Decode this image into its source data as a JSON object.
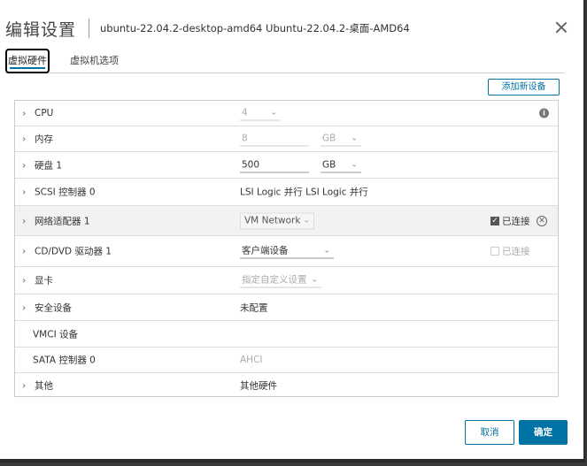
{
  "dialog": {
    "title": "编辑设置",
    "subtitle": "ubuntu-22.04.2-desktop-amd64 Ubuntu-22.04.2-桌面-AMD64"
  },
  "tabs": [
    {
      "label": "虚拟硬件",
      "active": true
    },
    {
      "label": "虚拟机选项",
      "active": false
    }
  ],
  "add_device_label": "添加新设备",
  "hardware": {
    "cpu": {
      "label": "CPU",
      "value": "4"
    },
    "memory": {
      "label": "内存",
      "value": "8",
      "unit": "GB"
    },
    "disk": {
      "label": "硬盘 1",
      "value": "500",
      "unit": "GB"
    },
    "scsi": {
      "label": "SCSI 控制器 0",
      "value": "LSI Logic 并行"
    },
    "network": {
      "label": "网络适配器 1",
      "value": "VM Network",
      "connected_label": "已连接",
      "connected": true
    },
    "cddvd": {
      "label": "CD/DVD 驱动器 1",
      "value": "客户端设备",
      "connected_label": "已连接",
      "connected": false
    },
    "video": {
      "label": "显卡",
      "value": "指定自定义设置"
    },
    "security": {
      "label": "安全设备",
      "value": "未配置"
    },
    "vmci": {
      "label": "VMCI 设备"
    },
    "sata": {
      "label": "SATA 控制器 0",
      "value": "AHCI"
    },
    "other": {
      "label": "其他",
      "value": "其他硬件"
    }
  },
  "footer": {
    "cancel_label": "取消",
    "ok_label": "确定"
  },
  "colors": {
    "accent": "#0072a3",
    "row_highlight": "#f2f2f2"
  }
}
